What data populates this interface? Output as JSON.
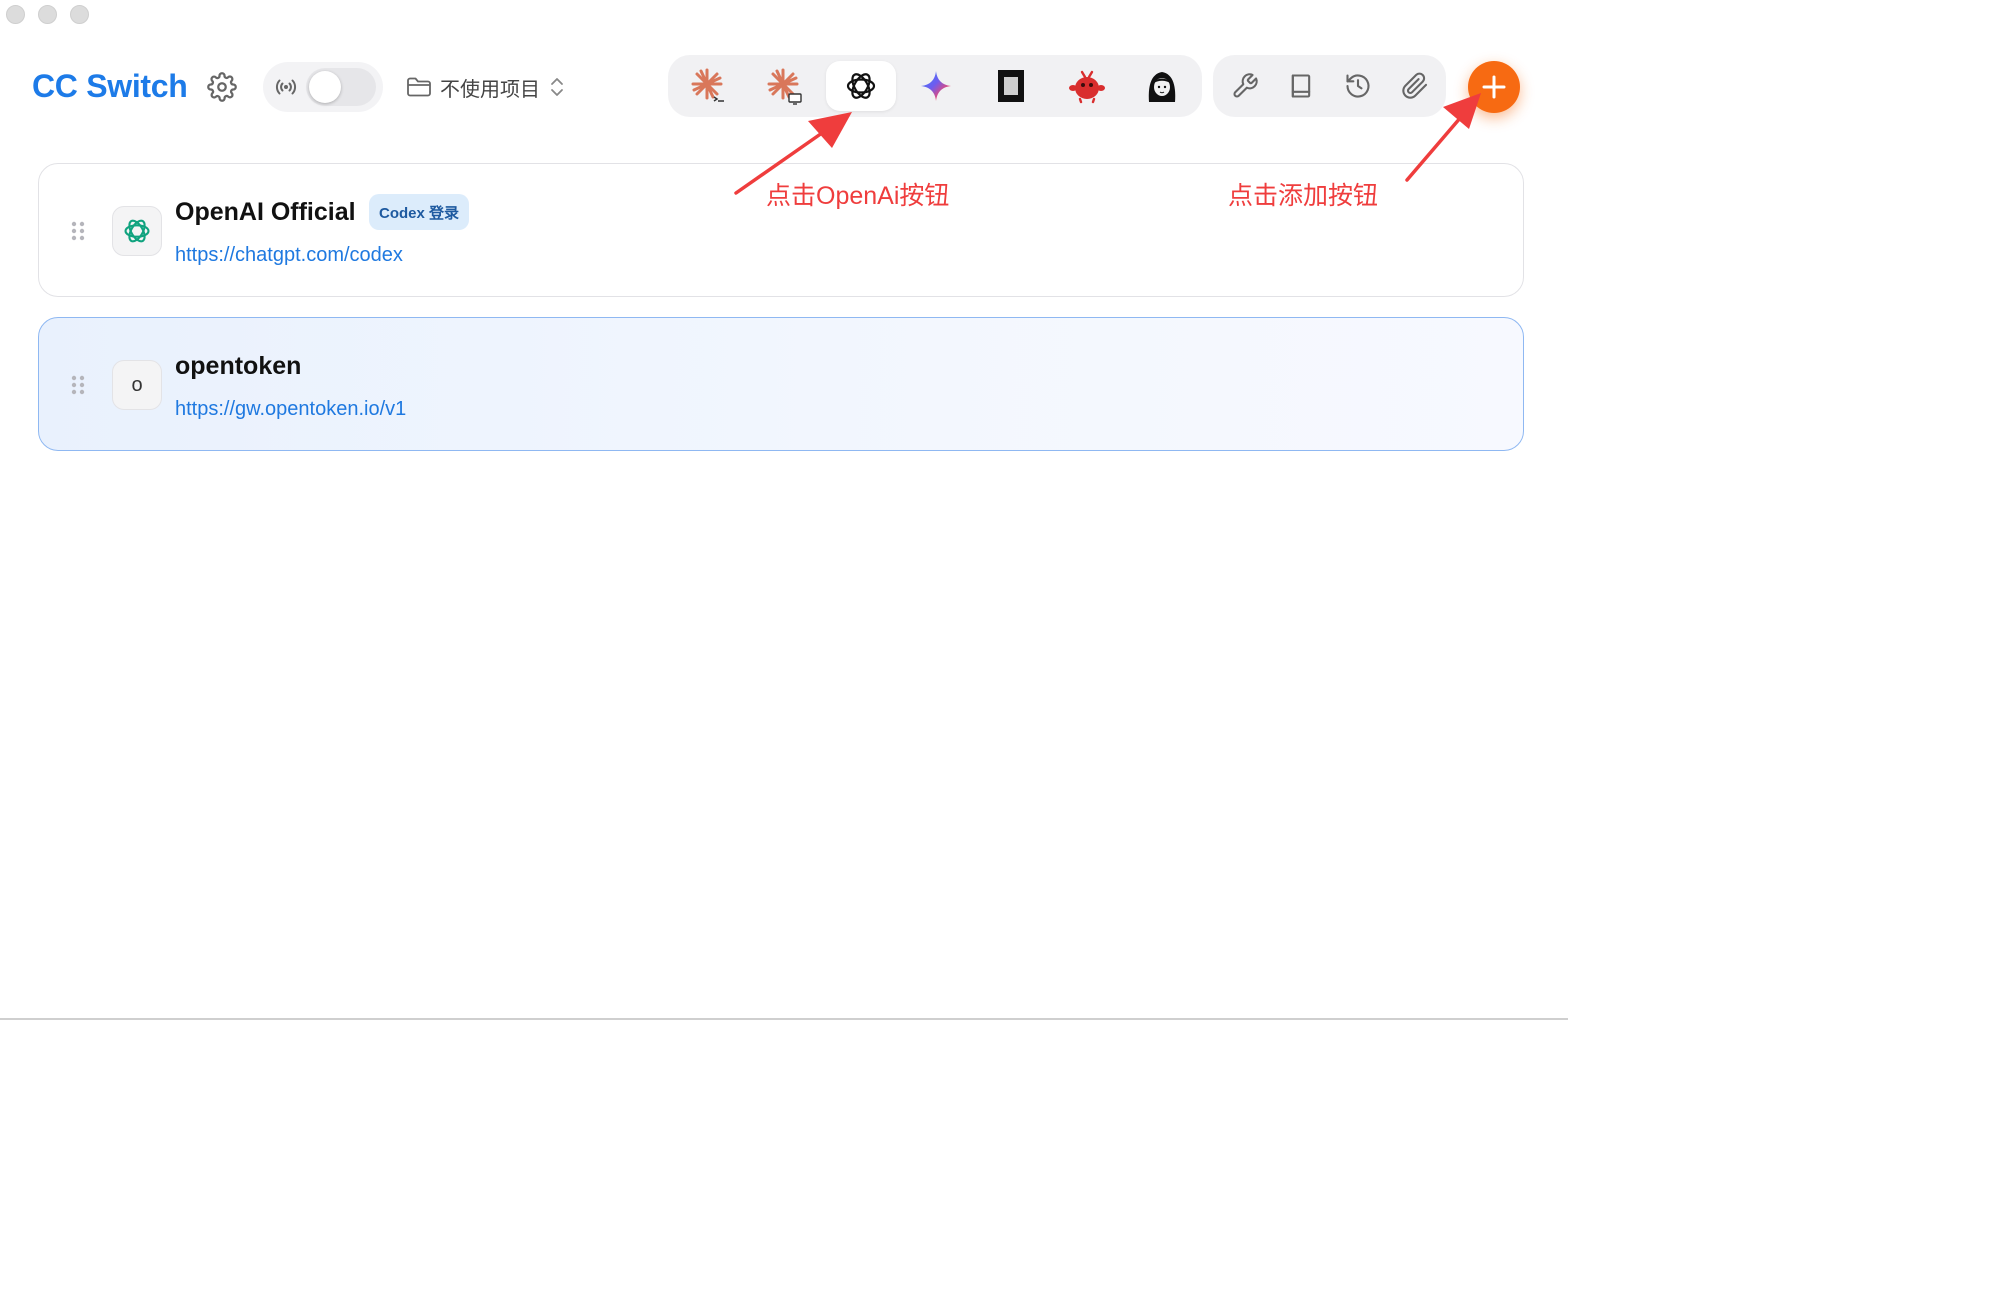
{
  "app_title": "CC Switch",
  "project_selector": {
    "label": "不使用项目"
  },
  "proxy": {
    "enabled": false
  },
  "app_switcher": {
    "active": "codex",
    "items": [
      {
        "id": "claude-code",
        "icon": "claude-terminal-icon"
      },
      {
        "id": "claude-desktop",
        "icon": "claude-desktop-icon"
      },
      {
        "id": "codex",
        "icon": "openai-icon"
      },
      {
        "id": "gemini",
        "icon": "gemini-icon"
      },
      {
        "id": "opencode",
        "icon": "opencode-icon"
      },
      {
        "id": "app-6",
        "icon": "red-mascot-icon"
      },
      {
        "id": "app-7",
        "icon": "girl-avatar-icon"
      }
    ]
  },
  "tools": [
    {
      "id": "mcp",
      "icon": "wrench-icon"
    },
    {
      "id": "prompts",
      "icon": "book-icon"
    },
    {
      "id": "history",
      "icon": "history-icon"
    },
    {
      "id": "skills",
      "icon": "paperclip-icon"
    }
  ],
  "providers": [
    {
      "name": "OpenAI Official",
      "badge": "Codex 登录",
      "url": "https://chatgpt.com/codex",
      "icon": "openai-icon",
      "selected": false
    },
    {
      "name": "opentoken",
      "url": "https://gw.opentoken.io/v1",
      "icon_letter": "o",
      "selected": true
    }
  ],
  "annotations": {
    "openai_hint": "点击OpenAi按钮",
    "add_hint": "点击添加按钮"
  },
  "colors": {
    "brand_blue": "#1d7be8",
    "accent_orange": "#f76a12",
    "annotation_red": "#ef3d3d",
    "link_blue": "#1f79e0"
  }
}
